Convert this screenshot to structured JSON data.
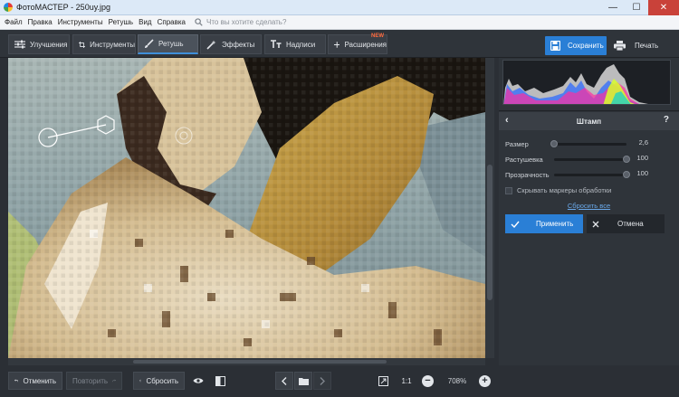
{
  "window": {
    "title": "ФотоМАСТЕР - 250uy.jpg"
  },
  "menu": {
    "items": [
      "Файл",
      "Правка",
      "Инструменты",
      "Ретушь",
      "Вид",
      "Справка"
    ],
    "search_placeholder": "Что вы хотите сделать?"
  },
  "tabs": [
    {
      "label": "Улучшения",
      "icon": "sliders-icon"
    },
    {
      "label": "Инструменты",
      "icon": "crop-icon"
    },
    {
      "label": "Ретушь",
      "icon": "brush-icon",
      "active": true
    },
    {
      "label": "Эффекты",
      "icon": "magic-wand-icon"
    },
    {
      "label": "Надписи",
      "icon": "text-icon"
    },
    {
      "label": "Расширения",
      "icon": "plus-icon",
      "badge": "NEW"
    }
  ],
  "actions": {
    "save_label": "Сохранить",
    "print_label": "Печать"
  },
  "panel": {
    "title": "Штамп",
    "help": "?",
    "sliders": [
      {
        "label": "Размер",
        "value_text": "2,6",
        "level": 0.0
      },
      {
        "label": "Растушевка",
        "value_text": "100",
        "level": 1.0
      },
      {
        "label": "Прозрачность",
        "value_text": "100",
        "level": 1.0
      }
    ],
    "hide_markers_label": "Скрывать маркеры обработки",
    "reset_all_label": "Сбросить все",
    "apply_label": "Применить",
    "cancel_label": "Отмена"
  },
  "bottom": {
    "undo_label": "Отменить",
    "redo_label": "Повторить",
    "reset_label": "Сбросить",
    "ratio_label": "1:1",
    "zoom_value": "708%"
  },
  "colors": {
    "accent": "#2a7fd6",
    "badge": "#ff6a3d",
    "panel": "#2f343a",
    "close": "#c9423a"
  }
}
